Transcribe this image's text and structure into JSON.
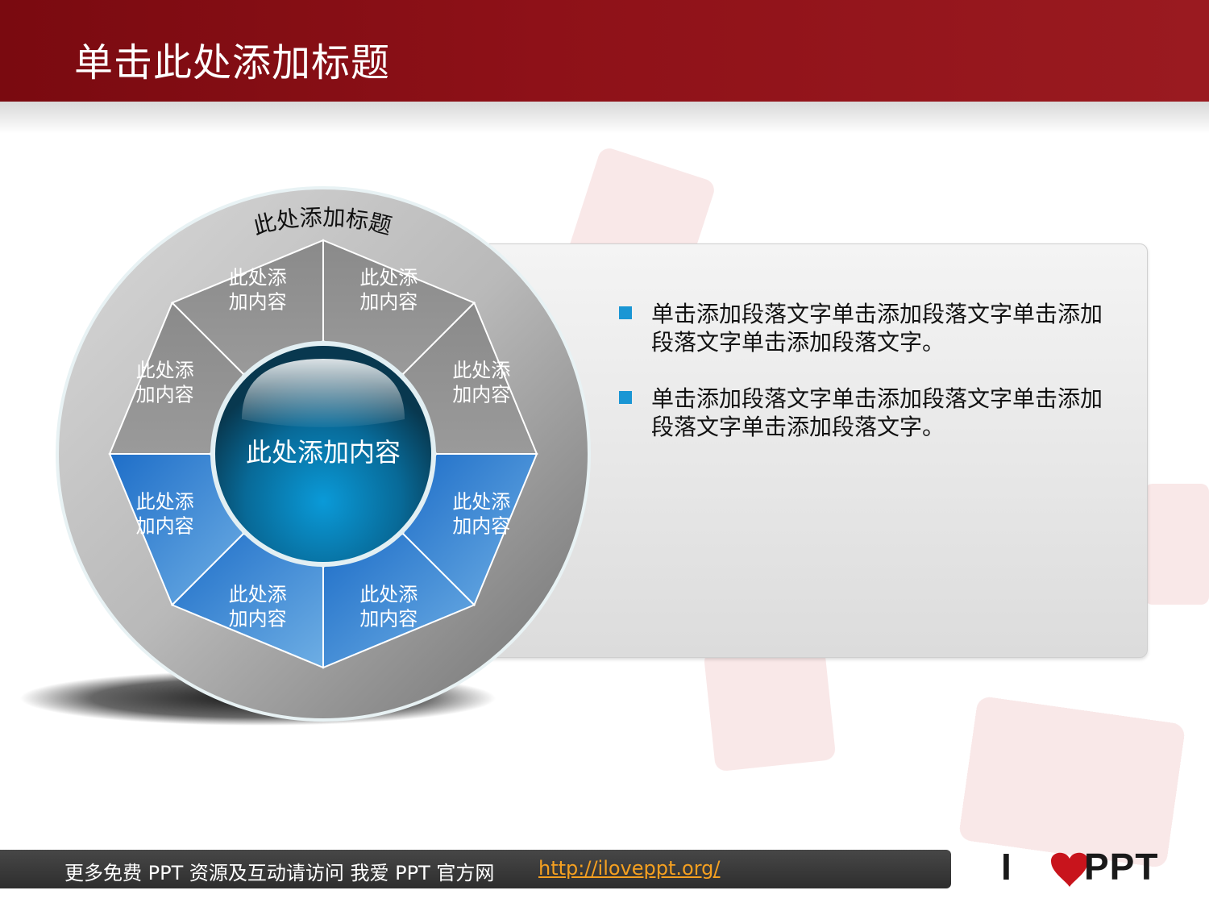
{
  "title": "单击此处添加标题",
  "diagram": {
    "ring_title": "此处添加标题",
    "center_label": "此处添加内容",
    "segments": [
      {
        "line1": "此处添",
        "line2": "加内容",
        "tone": "gray"
      },
      {
        "line1": "此处添",
        "line2": "加内容",
        "tone": "gray"
      },
      {
        "line1": "此处添",
        "line2": "加内容",
        "tone": "gray"
      },
      {
        "line1": "此处添",
        "line2": "加内容",
        "tone": "gray"
      },
      {
        "line1": "此处添",
        "line2": "加内容",
        "tone": "blue"
      },
      {
        "line1": "此处添",
        "line2": "加内容",
        "tone": "blue"
      },
      {
        "line1": "此处添",
        "line2": "加内容",
        "tone": "blue"
      },
      {
        "line1": "此处添",
        "line2": "加内容",
        "tone": "blue"
      }
    ],
    "colors": {
      "gray": "#8c8c8c",
      "blue": "#3a86d2",
      "accent": "#1a96d4",
      "title_bar": "#8b0e15"
    }
  },
  "bullets": [
    {
      "line1": "单击添加段落文字单击添加段落文字单击添加",
      "line2": "段落文字单击添加段落文字。"
    },
    {
      "line1": "单击添加段落文字单击添加段落文字单击添加",
      "line2": "段落文字单击添加段落文字。"
    }
  ],
  "footer": {
    "text": "更多免费 PPT 资源及互动请访问 我爱  PPT  官方网",
    "link": "http://iloveppt.org/"
  },
  "brand": {
    "left": "I",
    "right": "PPT"
  }
}
